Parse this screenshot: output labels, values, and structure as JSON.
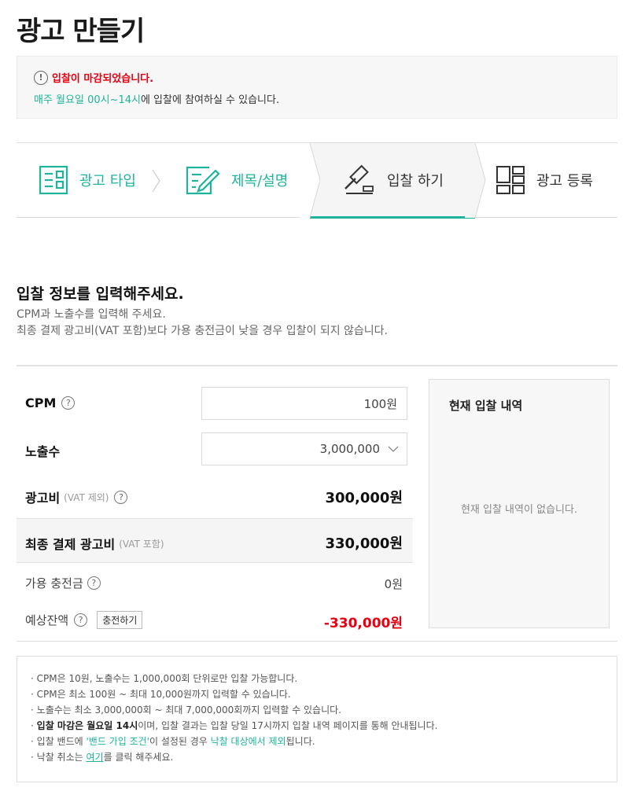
{
  "page": {
    "title": "광고 만들기"
  },
  "alert": {
    "icon": "exclamation-circle-icon",
    "title": "입찰이 마감되었습니다.",
    "schedule": "매주 월요일 00시~14시",
    "message_rest": "에 입찰에 참여하실 수 있습니다."
  },
  "steps": [
    {
      "label": "광고 타입",
      "icon": "ad-type-icon",
      "state": "done"
    },
    {
      "label": "제목/설명",
      "icon": "edit-icon",
      "state": "done"
    },
    {
      "label": "입찰 하기",
      "icon": "gavel-icon",
      "state": "current"
    },
    {
      "label": "광고 등록",
      "icon": "layout-grid-icon",
      "state": "upcoming"
    }
  ],
  "section": {
    "title": "입찰 정보를 입력해주세요.",
    "desc1": "CPM과 노출수를 입력해 주세요.",
    "desc2": "최종 결제 광고비(VAT 포함)보다 가용 충전금이 낮을 경우 입찰이 되지 않습니다."
  },
  "form": {
    "cpm": {
      "label": "CPM",
      "value": "100원"
    },
    "impressions": {
      "label": "노출수",
      "value": "3,000,000"
    },
    "ad_cost": {
      "label": "광고비",
      "note": "(VAT 제외)",
      "value": "300,000원"
    },
    "final_cost": {
      "label": "최종 결제 광고비",
      "note": "(VAT 포함)",
      "value": "330,000원"
    },
    "available": {
      "label": "가용 충전금",
      "value": "0원"
    },
    "balance": {
      "label": "예상잔액",
      "button": "충전하기",
      "value": "-330,000원"
    },
    "help_glyph": "?"
  },
  "side": {
    "title": "현재 입찰 내역",
    "empty": "현재 입찰 내역이 없습니다."
  },
  "notes": {
    "bullet": "·",
    "n1": "CPM은 10원, 노출수는 1,000,000회 단위로만 입찰 가능합니다.",
    "n2": "CPM은 최소 100원 ~ 최대 10,000원까지 입력할 수 있습니다.",
    "n3": "노출수는 최소 3,000,000회 ~ 최대 7,000,000회까지 입력할 수 있습니다.",
    "n4_bold": "입찰 마감은 월요일 14시",
    "n4_rest": "이며, 입찰 결과는 입찰 당일 17시까지 입찰 내역 페이지를 통해 안내됩니다.",
    "n5_a": "입찰 밴드에 ",
    "n5_link": "'밴드 가입 조건'",
    "n5_b": "이 설정된 경우 ",
    "n5_teal": "낙찰 대상에서 제외",
    "n5_c": "됩니다.",
    "n6_a": "낙찰 취소는 ",
    "n6_link": "여기",
    "n6_b": "를 클릭 해주세요."
  },
  "colors": {
    "accent": "#1db49b",
    "error": "#e60012"
  }
}
